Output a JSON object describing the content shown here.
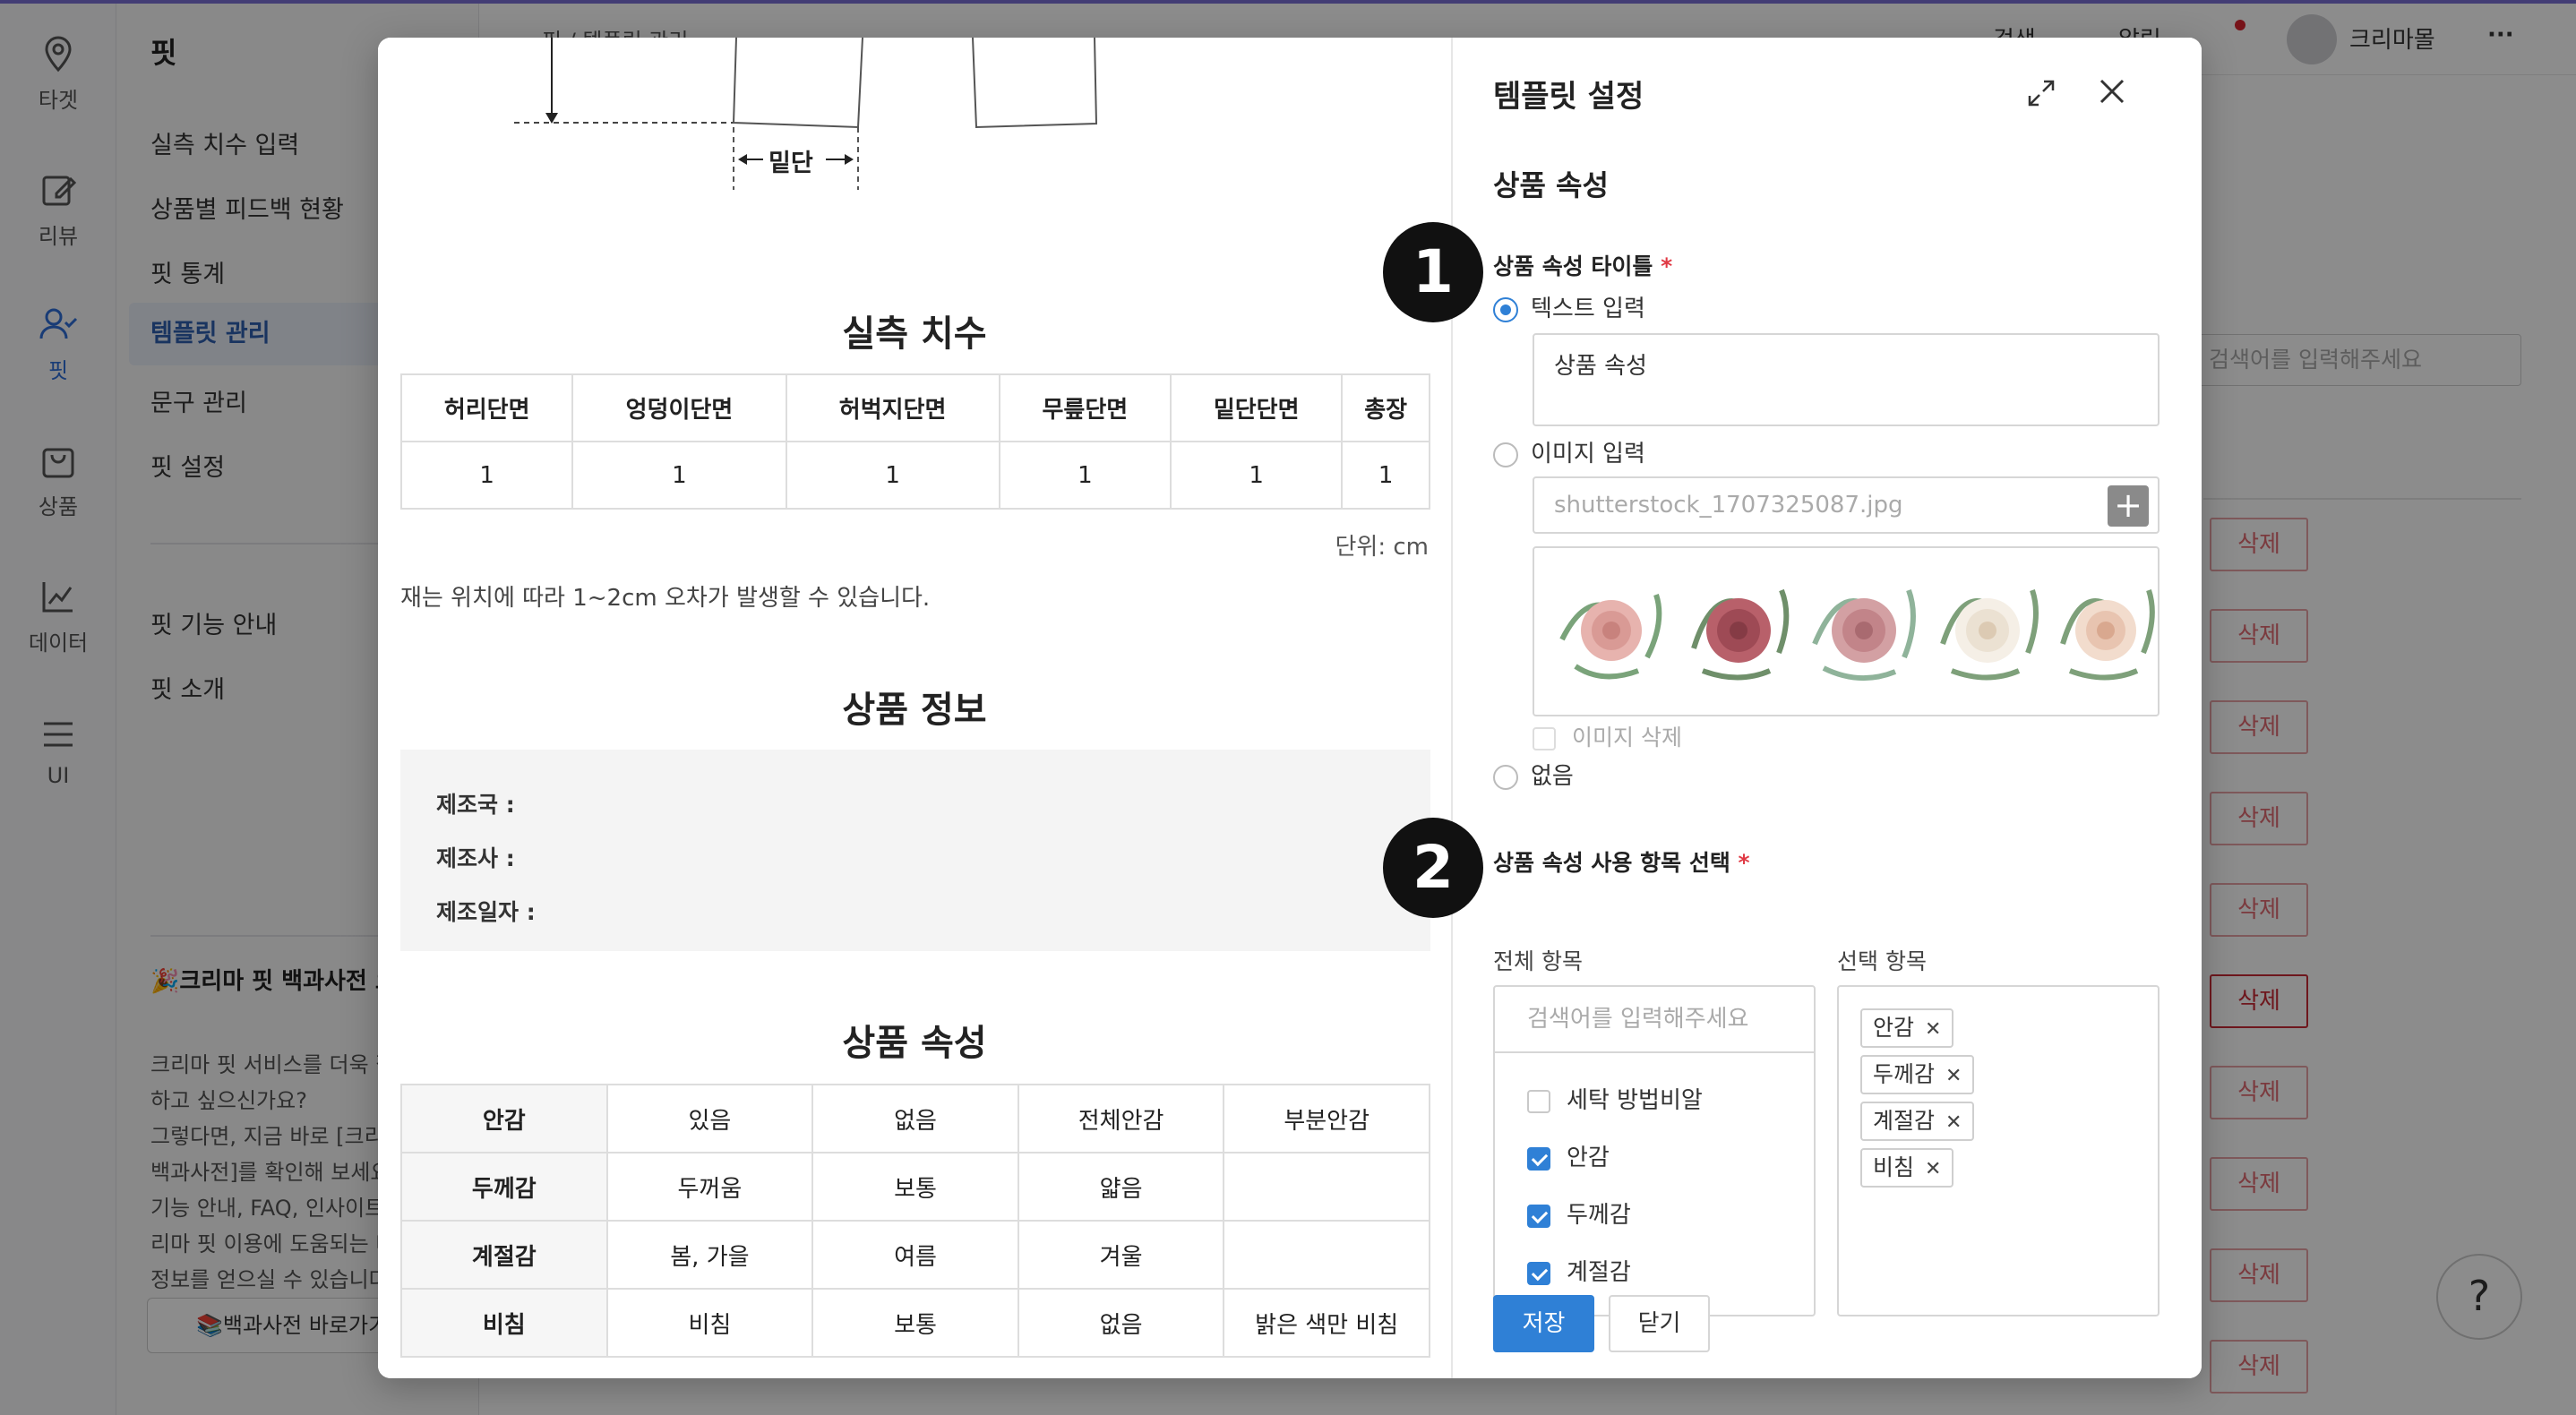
{
  "iconbar": {
    "items": [
      {
        "label": "타겟",
        "icon": "target-pin-icon"
      },
      {
        "label": "리뷰",
        "icon": "edit-icon"
      },
      {
        "label": "핏",
        "icon": "user-check-icon"
      },
      {
        "label": "상품",
        "icon": "shopping-bag-icon"
      },
      {
        "label": "데이터",
        "icon": "chart-line-icon"
      },
      {
        "label": "UI",
        "icon": "menu-icon"
      }
    ]
  },
  "sidemenu": {
    "title": "핏",
    "items": [
      "실측 치수 입력",
      "상품별 피드백 현황",
      "핏 통계",
      "템플릿 관리",
      "문구 관리",
      "핏 설정"
    ],
    "items2": [
      "핏 기능 안내",
      "핏 소개"
    ],
    "promo_title": "🎉크리마 핏 백과사전 오픈🎉",
    "promo_body": "크리마 핏 서비스를 더욱 잘\n하고 싶으신가요?\n그렇다면, 지금 바로 [크리\n백과사전]를 확인해 보세요\n기능 안내, FAQ, 인사이트\n리마 핏 이용에 도움되는 다\n정보를 얻으실 수 있습니다",
    "promo_button": "📚백과사전 바로가기"
  },
  "topbar": {
    "breadcrumb": "핏 / 템플릿 관리",
    "search": "검색",
    "notifications": "알림",
    "user": "크리마몰",
    "more": "···"
  },
  "background": {
    "search_placeholder": "검색어를 입력해주세요",
    "delete_label": "삭제",
    "help": "?"
  },
  "preview": {
    "diagram_label": "밑단",
    "measure_title": "실측 치수",
    "measure_headers": [
      "허리단면",
      "엉덩이단면",
      "허벅지단면",
      "무릎단면",
      "밑단단면",
      "총장"
    ],
    "measure_values": [
      "1",
      "1",
      "1",
      "1",
      "1",
      "1"
    ],
    "unit": "단위: cm",
    "note": "재는 위치에 따라 1~2cm 오차가 발생할 수 있습니다.",
    "info_title": "상품 정보",
    "info_rows": [
      "제조국 :",
      "제조사 :",
      "제조일자 :"
    ],
    "attr_title": "상품 속성",
    "attr_rows": [
      {
        "name": "안감",
        "values": [
          "있음",
          "없음",
          "전체안감",
          "부분안감"
        ]
      },
      {
        "name": "두께감",
        "values": [
          "두꺼움",
          "보통",
          "얇음",
          ""
        ]
      },
      {
        "name": "계절감",
        "values": [
          "봄, 가을",
          "여름",
          "겨울",
          ""
        ]
      },
      {
        "name": "비침",
        "values": [
          "비침",
          "보통",
          "없음",
          "밝은 색만 비침"
        ]
      }
    ]
  },
  "settings": {
    "title": "템플릿 설정",
    "section": "상품 속성",
    "step1": "1",
    "step2": "2",
    "title_field_label": "상품 속성 타이틀",
    "required_mark": "*",
    "option_text": "텍스트 입력",
    "text_value": "상품 속성",
    "option_image": "이미지 입력",
    "file_name": "shutterstock_1707325087.jpg",
    "add_symbol": "+",
    "image_delete": "이미지 삭제",
    "option_none": "없음",
    "items_field_label": "상품 속성 사용 항목 선택",
    "all_items_label": "전체 항목",
    "selected_items_label": "선택 항목",
    "search_placeholder": "검색어를 입력해주세요",
    "all_items": [
      {
        "label": "세탁 방법비알",
        "checked": false
      },
      {
        "label": "안감",
        "checked": true
      },
      {
        "label": "두께감",
        "checked": true
      },
      {
        "label": "계절감",
        "checked": true
      }
    ],
    "selected_items": [
      "안감",
      "두께감",
      "계절감",
      "비침"
    ],
    "chip_remove": "✕",
    "save": "저장",
    "close": "닫기"
  },
  "colors": {
    "accent": "#2f80d6",
    "danger": "#c92a35",
    "active_menu": "#2f5fb0"
  }
}
